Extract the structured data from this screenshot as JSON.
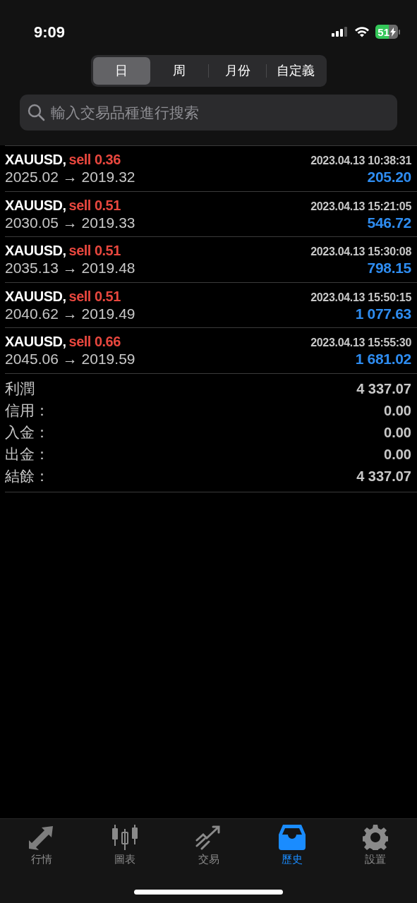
{
  "status_bar": {
    "time": "9:09",
    "battery": "51"
  },
  "period_tabs": [
    {
      "label": "日",
      "selected": true
    },
    {
      "label": "周",
      "selected": false
    },
    {
      "label": "月份",
      "selected": false
    },
    {
      "label": "自定義",
      "selected": false
    }
  ],
  "search": {
    "placeholder": "輸入交易品種進行搜索"
  },
  "trades": [
    {
      "symbol": "XAUUSD,",
      "order": "sell 0.36",
      "time": "2023.04.13 10:38:31",
      "prices": "2025.02 → 2019.32",
      "profit": "205.20"
    },
    {
      "symbol": "XAUUSD,",
      "order": "sell 0.51",
      "time": "2023.04.13 15:21:05",
      "prices": "2030.05 → 2019.33",
      "profit": "546.72"
    },
    {
      "symbol": "XAUUSD,",
      "order": "sell 0.51",
      "time": "2023.04.13 15:30:08",
      "prices": "2035.13 → 2019.48",
      "profit": "798.15"
    },
    {
      "symbol": "XAUUSD,",
      "order": "sell 0.51",
      "time": "2023.04.13 15:50:15",
      "prices": "2040.62 → 2019.49",
      "profit": "1 077.63"
    },
    {
      "symbol": "XAUUSD,",
      "order": "sell 0.66",
      "time": "2023.04.13 15:55:30",
      "prices": "2045.06 → 2019.59",
      "profit": "1 681.02"
    }
  ],
  "summary": [
    {
      "label": "利潤",
      "value": "4 337.07"
    },
    {
      "label": "信用：",
      "value": "0.00"
    },
    {
      "label": "入金：",
      "value": "0.00"
    },
    {
      "label": "出金：",
      "value": "0.00"
    },
    {
      "label": "結餘：",
      "value": "4 337.07"
    }
  ],
  "bottom_nav": [
    {
      "label": "行情",
      "kind": "quotes",
      "selected": false
    },
    {
      "label": "圖表",
      "kind": "chart",
      "selected": false
    },
    {
      "label": "交易",
      "kind": "trade",
      "selected": false
    },
    {
      "label": "歷史",
      "kind": "history",
      "selected": true
    },
    {
      "label": "設置",
      "kind": "settings",
      "selected": false
    }
  ]
}
